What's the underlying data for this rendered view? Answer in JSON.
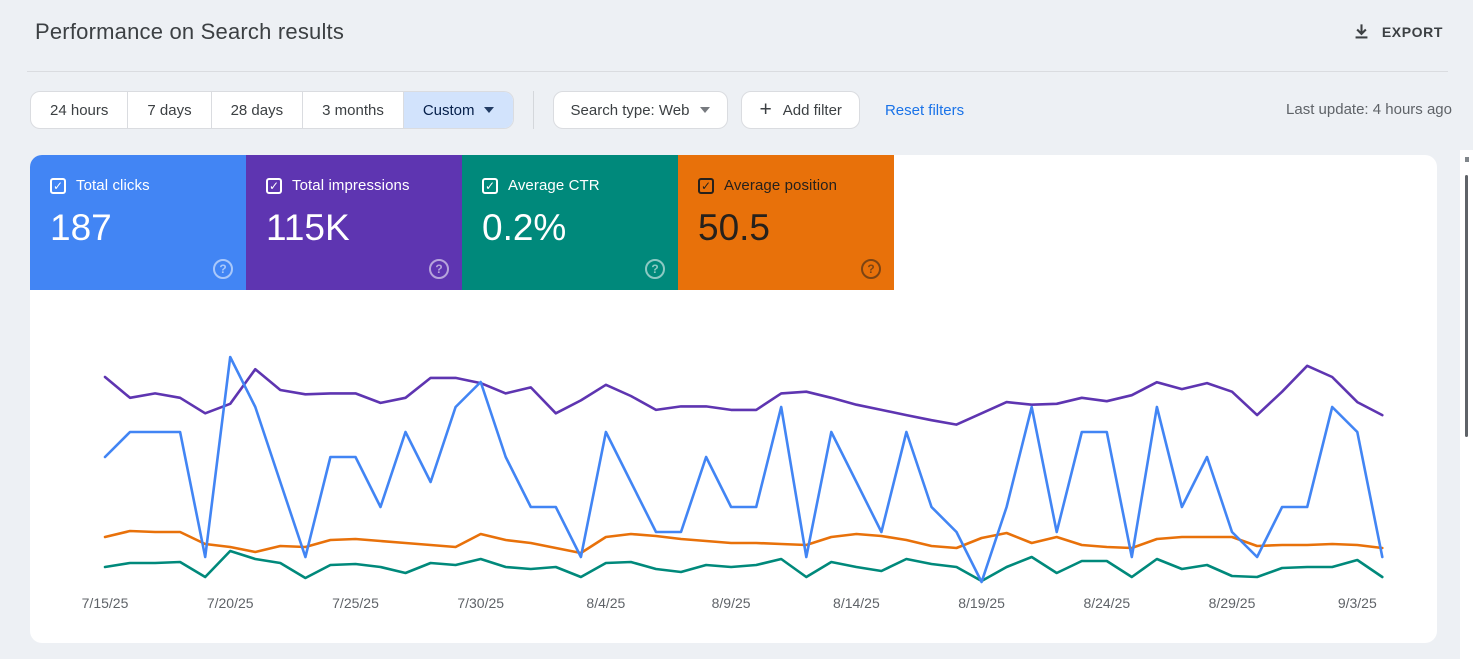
{
  "header": {
    "title": "Performance on Search results",
    "export_label": "EXPORT"
  },
  "filters": {
    "date_ranges": [
      {
        "label": "24 hours",
        "selected": false
      },
      {
        "label": "7 days",
        "selected": false
      },
      {
        "label": "28 days",
        "selected": false
      },
      {
        "label": "3 months",
        "selected": false
      },
      {
        "label": "Custom",
        "selected": true
      }
    ],
    "search_type": "Search type: Web",
    "add_filter": "Add filter",
    "reset_filters": "Reset filters",
    "last_update": "Last update: 4 hours ago"
  },
  "metrics": [
    {
      "id": "clicks",
      "label": "Total clicks",
      "value": "187",
      "color": "#4285f4",
      "text_color": "#ffffff",
      "checked": true,
      "check_glyph": "✓",
      "help_glyph": "?"
    },
    {
      "id": "impressions",
      "label": "Total impressions",
      "value": "115K",
      "color": "#5e35b1",
      "text_color": "#ffffff",
      "checked": true,
      "check_glyph": "✓",
      "help_glyph": "?"
    },
    {
      "id": "ctr",
      "label": "Average CTR",
      "value": "0.2%",
      "color": "#00897b",
      "text_color": "#ffffff",
      "checked": true,
      "check_glyph": "✓",
      "help_glyph": "?"
    },
    {
      "id": "position",
      "label": "Average position",
      "value": "50.5",
      "color": "#e8710a",
      "text_color": "#26211c",
      "checked": true,
      "check_glyph": "✓",
      "help_glyph": "?"
    }
  ],
  "chart_data": {
    "type": "line",
    "x": [
      "7/15/25",
      "7/16/25",
      "7/17/25",
      "7/18/25",
      "7/19/25",
      "7/20/25",
      "7/21/25",
      "7/22/25",
      "7/23/25",
      "7/24/25",
      "7/25/25",
      "7/26/25",
      "7/27/25",
      "7/28/25",
      "7/29/25",
      "7/30/25",
      "7/31/25",
      "8/1/25",
      "8/2/25",
      "8/3/25",
      "8/4/25",
      "8/5/25",
      "8/6/25",
      "8/7/25",
      "8/8/25",
      "8/9/25",
      "8/10/25",
      "8/11/25",
      "8/12/25",
      "8/13/25",
      "8/14/25",
      "8/15/25",
      "8/16/25",
      "8/17/25",
      "8/18/25",
      "8/19/25",
      "8/20/25",
      "8/21/25",
      "8/22/25",
      "8/23/25",
      "8/24/25",
      "8/25/25",
      "8/26/25",
      "8/27/25",
      "8/28/25",
      "8/29/25",
      "8/30/25",
      "8/31/25",
      "9/1/25",
      "9/2/25",
      "9/3/25",
      "9/4/25"
    ],
    "tick_labels": [
      "7/15/25",
      "7/20/25",
      "7/25/25",
      "7/30/25",
      "8/4/25",
      "8/9/25",
      "8/14/25",
      "8/19/25",
      "8/24/25",
      "8/29/25",
      "9/3/25"
    ],
    "series": [
      {
        "id": "clicks",
        "name": "Total clicks",
        "color": "#4285f4",
        "unit": "clicks",
        "values": [
          5,
          6,
          6,
          6,
          1,
          9,
          7,
          4,
          1,
          5,
          5,
          3,
          6,
          4,
          7,
          8,
          5,
          3,
          3,
          1,
          6,
          4,
          2,
          2,
          5,
          3,
          3,
          7,
          1,
          6,
          4,
          2,
          6,
          3,
          2,
          0,
          3,
          7,
          2,
          6,
          6,
          1,
          7,
          3,
          5,
          2,
          1,
          3,
          3,
          7,
          6,
          1
        ]
      },
      {
        "id": "impressions",
        "name": "Total impressions",
        "color": "#5e35b1",
        "unit": "impressions",
        "values": [
          2370,
          2130,
          2180,
          2130,
          1950,
          2060,
          2460,
          2220,
          2170,
          2180,
          2180,
          2070,
          2130,
          2360,
          2360,
          2300,
          2180,
          2250,
          1950,
          2100,
          2280,
          2150,
          1990,
          2030,
          2030,
          1990,
          1990,
          2180,
          2200,
          2130,
          2050,
          1990,
          1930,
          1870,
          1820,
          1950,
          2080,
          2050,
          2060,
          2130,
          2090,
          2160,
          2310,
          2230,
          2300,
          2200,
          1930,
          2200,
          2500,
          2370,
          2080,
          1930
        ]
      },
      {
        "id": "ctr",
        "name": "Average CTR",
        "color": "#00897b",
        "unit": "%",
        "values": [
          0.18,
          0.22,
          0.22,
          0.23,
          0.08,
          0.34,
          0.26,
          0.22,
          0.07,
          0.2,
          0.21,
          0.18,
          0.12,
          0.22,
          0.2,
          0.26,
          0.18,
          0.16,
          0.18,
          0.08,
          0.22,
          0.23,
          0.16,
          0.13,
          0.2,
          0.18,
          0.2,
          0.26,
          0.08,
          0.23,
          0.18,
          0.14,
          0.26,
          0.21,
          0.18,
          0.04,
          0.18,
          0.28,
          0.12,
          0.24,
          0.24,
          0.08,
          0.26,
          0.16,
          0.2,
          0.09,
          0.08,
          0.17,
          0.18,
          0.18,
          0.25,
          0.08
        ]
      },
      {
        "id": "position",
        "name": "Average position",
        "color": "#e8710a",
        "unit": "position",
        "values": [
          49.7,
          48.5,
          48.7,
          48.7,
          51.1,
          51.7,
          52.7,
          51.5,
          51.7,
          50.3,
          50.1,
          50.5,
          50.9,
          51.3,
          51.7,
          49.1,
          50.3,
          50.9,
          51.9,
          52.9,
          49.7,
          49.1,
          49.5,
          50.1,
          50.5,
          50.9,
          50.9,
          51.1,
          51.3,
          49.7,
          49.1,
          49.5,
          50.3,
          51.5,
          51.9,
          49.9,
          48.9,
          50.9,
          49.7,
          51.3,
          51.7,
          51.9,
          50.1,
          49.7,
          49.7,
          49.7,
          51.5,
          51.3,
          51.3,
          51.1,
          51.3,
          51.9
        ]
      }
    ],
    "title": "",
    "xlabel": "",
    "ylabel": "",
    "y_axis": "hidden (each series independently scaled, values estimated from line positions)",
    "grid": false,
    "legend_position": "none"
  }
}
